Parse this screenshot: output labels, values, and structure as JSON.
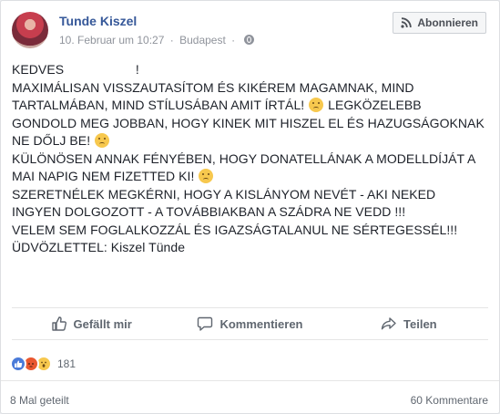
{
  "post": {
    "author": "Tunde Kiszel",
    "date": "10. Februar um 10:27",
    "location": "Budapest",
    "separator": "·",
    "subscribe_label": "Abonnieren",
    "lines": {
      "l1": "KEDVES                    !",
      "l2": "MAXIMÁLISAN VISSZAUTASÍTOM ÉS KIKÉREM MAGAMNAK, MIND TARTALMÁBAN, MIND STÍLUSÁBAN AMIT ÍRTÁL!",
      "l3": "LEGKÖZELEBB GONDOLD MEG JOBBAN, HOGY KINEK MIT HISZEL EL ÉS HAZUGSÁGOKNAK NE DŐLJ BE!",
      "l4": "KÜLÖNÖSEN ANNAK FÉNYÉBEN, HOGY DONATELLÁNAK A MODELLDÍJÁT A MAI NAPIG NEM FIZETTED KI!",
      "l5": "SZERETNÉLEK MEGKÉRNI, HOGY A KISLÁNYOM NEVÉT - AKI NEKED INGYEN DOLGOZOTT - A TOVÁBBIAKBAN A SZÁDRA NE VEDD !!!",
      "l6": "VELEM SEM FOGLALKOZZÁL ÉS IGAZSÁGTALANUL NE SÉRTEGESSÉL!!!",
      "l7": "ÜDVÖZLETTEL: Kiszel Tünde"
    }
  },
  "actions": {
    "like": "Gefällt mir",
    "comment": "Kommentieren",
    "share": "Teilen"
  },
  "reactions": {
    "count": "181",
    "types": [
      "like",
      "angry",
      "wow"
    ]
  },
  "footer": {
    "shares": "8 Mal geteilt",
    "comments": "60 Kommentare"
  },
  "colors": {
    "author_link": "#365899",
    "meta_grey": "#90949c",
    "action_grey": "#606770",
    "like_blue": "#4a7bd9"
  }
}
